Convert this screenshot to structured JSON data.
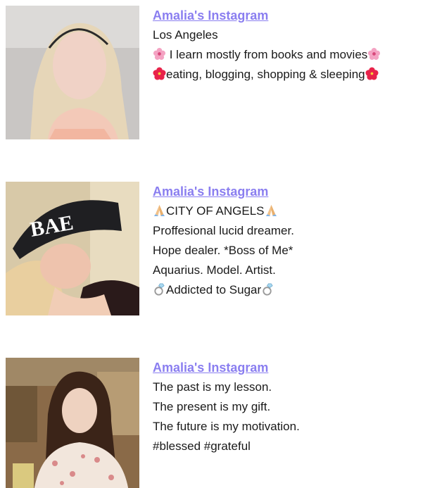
{
  "profiles": [
    {
      "title": "Amalia's Instagram",
      "photo_icon": "profile-photo",
      "lines": [
        {
          "pre": "",
          "text": "Los Angeles",
          "post": ""
        },
        {
          "pre": "cherry-blossom-icon",
          "text": " I learn mostly from books and movies",
          "post": "cherry-blossom-icon"
        },
        {
          "pre": "hibiscus-icon",
          "text": "eating, blogging, shopping & sleeping",
          "post": "hibiscus-icon"
        }
      ]
    },
    {
      "title": "Amalia's Instagram",
      "photo_icon": "profile-photo",
      "cap_text": "BAE",
      "lines": [
        {
          "pre": "folded-hands-icon",
          "text": "CITY OF ANGELS",
          "post": "folded-hands-icon"
        },
        {
          "pre": "",
          "text": "Proffesional lucid dreamer.",
          "post": ""
        },
        {
          "pre": "",
          "text": "Hope dealer. *Boss of Me*",
          "post": ""
        },
        {
          "pre": "",
          "text": "Aquarius. Model. Artist.",
          "post": ""
        },
        {
          "pre": "ring-icon",
          "text": "Addicted to Sugar",
          "post": "ring-icon"
        }
      ]
    },
    {
      "title": "Amalia's Instagram",
      "photo_icon": "profile-photo",
      "lines": [
        {
          "pre": "",
          "text": "The past is my lesson.",
          "post": ""
        },
        {
          "pre": "",
          "text": "The present is my gift.",
          "post": ""
        },
        {
          "pre": "",
          "text": "The future is my motivation.",
          "post": ""
        },
        {
          "pre": "",
          "text": "#blessed #grateful",
          "post": ""
        }
      ]
    }
  ],
  "colors": {
    "link": "#8a7ef0",
    "text": "#1a1a1a",
    "background": "#ffffff"
  }
}
